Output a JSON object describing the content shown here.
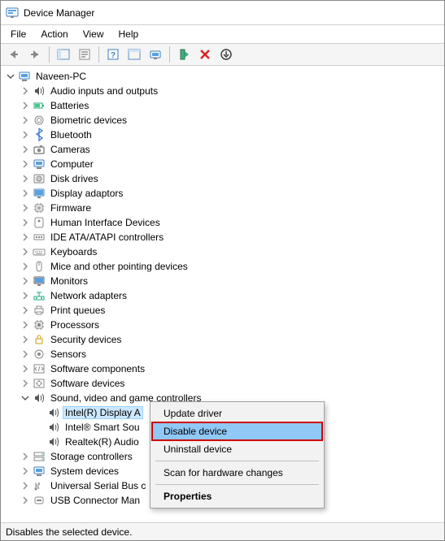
{
  "window": {
    "title": "Device Manager"
  },
  "menubar": {
    "file": "File",
    "action": "Action",
    "view": "View",
    "help": "Help"
  },
  "root": {
    "name": "Naveen-PC"
  },
  "categories": [
    {
      "label": "Audio inputs and outputs",
      "icon": "speaker"
    },
    {
      "label": "Batteries",
      "icon": "battery"
    },
    {
      "label": "Biometric devices",
      "icon": "finger"
    },
    {
      "label": "Bluetooth",
      "icon": "bluetooth"
    },
    {
      "label": "Cameras",
      "icon": "camera"
    },
    {
      "label": "Computer",
      "icon": "computer"
    },
    {
      "label": "Disk drives",
      "icon": "disk"
    },
    {
      "label": "Display adaptors",
      "icon": "display"
    },
    {
      "label": "Firmware",
      "icon": "chip"
    },
    {
      "label": "Human Interface Devices",
      "icon": "hid"
    },
    {
      "label": "IDE ATA/ATAPI controllers",
      "icon": "ide"
    },
    {
      "label": "Keyboards",
      "icon": "keyboard"
    },
    {
      "label": "Mice and other pointing devices",
      "icon": "mouse"
    },
    {
      "label": "Monitors",
      "icon": "monitor"
    },
    {
      "label": "Network adapters",
      "icon": "network"
    },
    {
      "label": "Print queues",
      "icon": "printer"
    },
    {
      "label": "Processors",
      "icon": "cpu"
    },
    {
      "label": "Security devices",
      "icon": "security"
    },
    {
      "label": "Sensors",
      "icon": "sensor"
    },
    {
      "label": "Software components",
      "icon": "swcomp"
    },
    {
      "label": "Software devices",
      "icon": "swdev"
    }
  ],
  "soundCategory": {
    "label": "Sound, video and game controllers",
    "children": [
      {
        "label": "Intel(R) Display A",
        "selected": true
      },
      {
        "label": "Intel® Smart Sou"
      },
      {
        "label": "Realtek(R) Audio"
      }
    ]
  },
  "postCategories": [
    {
      "label": "Storage controllers",
      "icon": "storage"
    },
    {
      "label": "System devices",
      "icon": "system"
    },
    {
      "label": "Universal Serial Bus c",
      "icon": "usb"
    },
    {
      "label": "USB Connector Man",
      "icon": "usbconn"
    }
  ],
  "contextMenu": {
    "update": "Update driver",
    "disable": "Disable device",
    "uninstall": "Uninstall device",
    "scan": "Scan for hardware changes",
    "properties": "Properties"
  },
  "status": "Disables the selected device."
}
